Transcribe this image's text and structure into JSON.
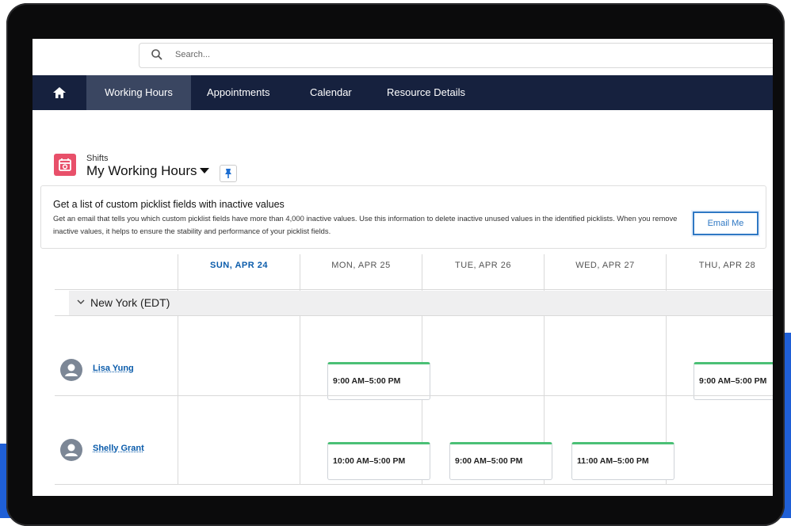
{
  "search": {
    "placeholder": "Search..."
  },
  "nav": {
    "tabs": [
      {
        "label": "Working Hours"
      },
      {
        "label": "Appointments"
      },
      {
        "label": "Calendar"
      },
      {
        "label": "Resource Details"
      }
    ]
  },
  "header": {
    "object_label": "Shifts",
    "title": "My Working Hours"
  },
  "banner": {
    "title": "Get a list of custom picklist fields with inactive values",
    "text": "Get an email that tells you which custom picklist fields have more than 4,000 inactive values. Use this information to delete inactive unused values in the identified picklists. When you remove inactive values, it helps to ensure the stability and performance of your picklist fields.",
    "email_button": "Email Me"
  },
  "calendar": {
    "days": [
      "SUN, APR 24",
      "MON, APR 25",
      "TUE, APR 26",
      "WED, APR 27",
      "THU, APR 28"
    ],
    "group": "New York (EDT)",
    "resources": [
      {
        "name": "Lisa Yung",
        "shifts": [
          "",
          "9:00 AM–5:00 PM",
          "",
          "",
          "9:00 AM–5:00 PM"
        ]
      },
      {
        "name": "Shelly Grant",
        "shifts": [
          "",
          "10:00 AM–5:00 PM",
          "9:00 AM–5:00 PM",
          "11:00 AM–5:00 PM",
          ""
        ]
      }
    ]
  },
  "colors": {
    "nav_bg": "#16213e",
    "active_tab": "#3a4661",
    "accent": "#0b5cab",
    "shift_bar": "#4bc076",
    "app_icon": "#e8506a"
  }
}
